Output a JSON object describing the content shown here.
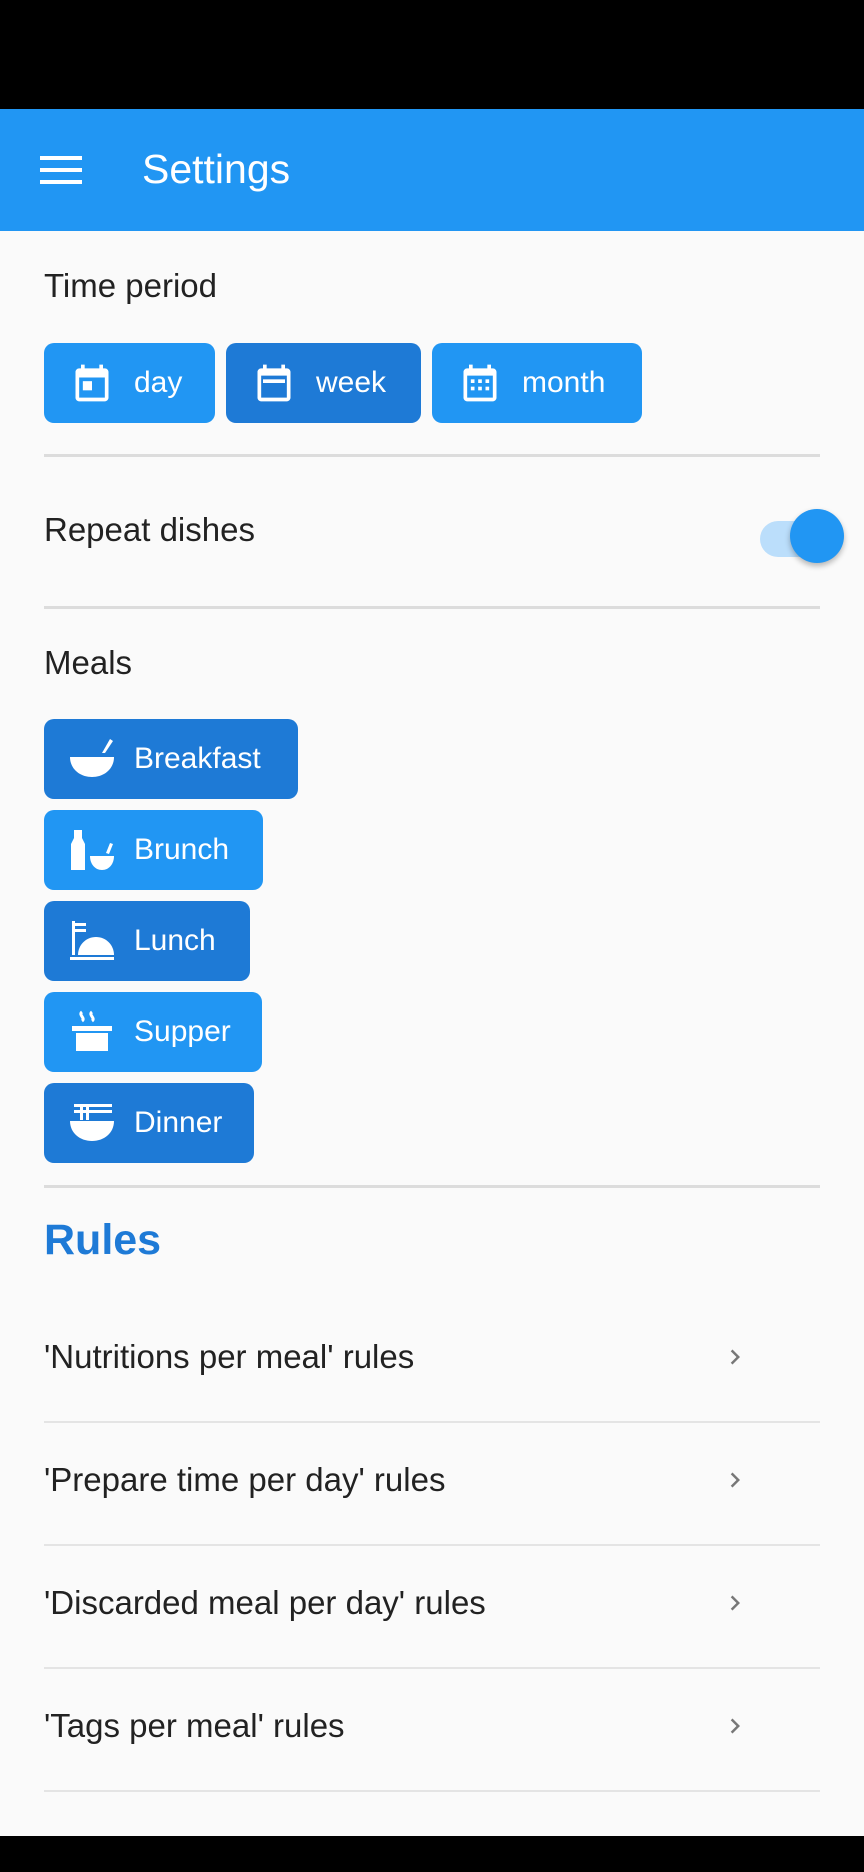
{
  "app_bar": {
    "title": "Settings"
  },
  "time_period": {
    "label": "Time period",
    "options": [
      {
        "label": "day",
        "icon": "calendar-day-icon",
        "selected": false
      },
      {
        "label": "week",
        "icon": "calendar-week-icon",
        "selected": true
      },
      {
        "label": "month",
        "icon": "calendar-month-icon",
        "selected": false
      }
    ]
  },
  "repeat_dishes": {
    "label": "Repeat dishes",
    "enabled": true
  },
  "meals": {
    "label": "Meals",
    "items": [
      {
        "label": "Breakfast",
        "icon": "bowl-icon",
        "selected": true
      },
      {
        "label": "Brunch",
        "icon": "bottle-bowl-icon",
        "selected": false
      },
      {
        "label": "Lunch",
        "icon": "plate-icon",
        "selected": true
      },
      {
        "label": "Supper",
        "icon": "steaming-pot-icon",
        "selected": false
      },
      {
        "label": "Dinner",
        "icon": "noodle-bowl-icon",
        "selected": true
      }
    ]
  },
  "rules": {
    "title": "Rules",
    "items": [
      {
        "label": "'Nutritions per meal' rules"
      },
      {
        "label": "'Prepare time per day' rules"
      },
      {
        "label": "'Discarded meal per day' rules"
      },
      {
        "label": "'Tags per meal' rules"
      }
    ]
  },
  "colors": {
    "primary": "#2196f3",
    "primary_dark": "#1e7ad6",
    "switch_track": "#bbdefb",
    "background": "#fafafa"
  }
}
